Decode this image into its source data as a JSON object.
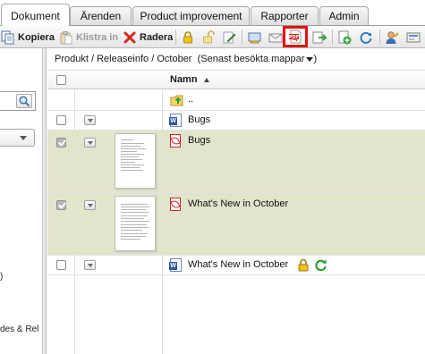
{
  "tabs": [
    {
      "label": "Dokument",
      "active": true
    },
    {
      "label": "Ärenden",
      "active": false
    },
    {
      "label": "Product improvement",
      "active": false
    },
    {
      "label": "Rapporter",
      "active": false
    },
    {
      "label": "Admin",
      "active": false
    }
  ],
  "toolbar": {
    "copy_label": "Kopiera",
    "paste_label": "Klistra in",
    "delete_label": "Radera",
    "icons": [
      "copy-icon",
      "paste-icon",
      "delete-icon",
      "lock-icon",
      "unlock-icon",
      "edit-icon",
      "move-icon",
      "email-icon",
      "pdf-icon",
      "export-icon",
      "add-icon",
      "refresh-icon",
      "user-icon",
      "settings-icon"
    ],
    "highlight_color": "#e3120b"
  },
  "leftpane": {
    "partial_text_1": ")",
    "partial_text_2": "des & Rel"
  },
  "breadcrumb": {
    "path": "Produkt / Releaseinfo / October",
    "recent": "(Senast besökta mappar"
  },
  "grid": {
    "column_name": "Namn",
    "parent_label": "..",
    "rows": [
      {
        "name": "Bugs",
        "type": "word",
        "checked": false,
        "thumbnail": false
      },
      {
        "name": "Bugs",
        "type": "pdf",
        "checked": true,
        "thumbnail": true
      },
      {
        "name": "What's New in October",
        "type": "pdf",
        "checked": true,
        "thumbnail": true
      },
      {
        "name": "What's New in October",
        "type": "word",
        "checked": false,
        "thumbnail": false,
        "locked": true,
        "refresh": true
      }
    ]
  },
  "colors": {
    "selected_row": "#e3e4cc",
    "pdf_red": "#c8242b",
    "word_blue": "#2c57a8"
  }
}
